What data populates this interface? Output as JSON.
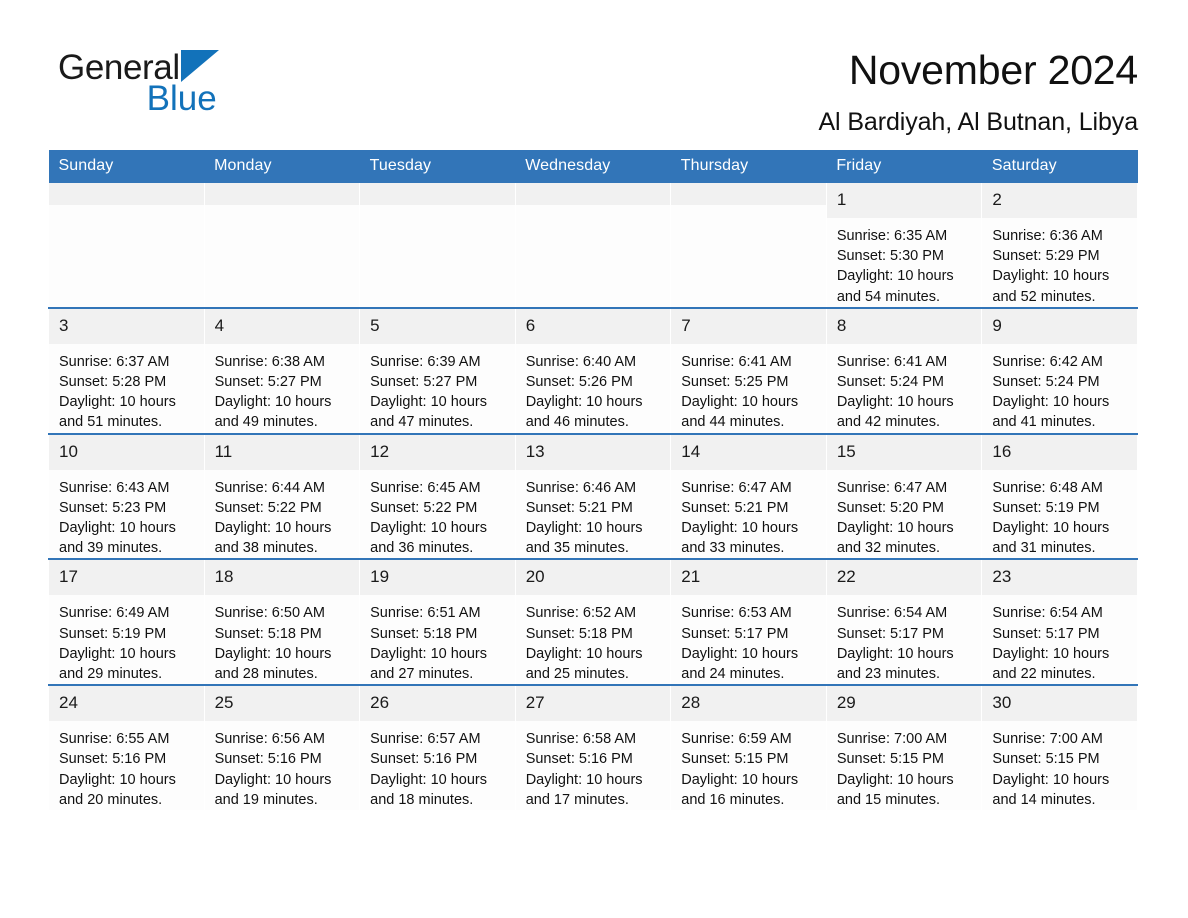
{
  "brand": {
    "word1": "General",
    "word2": "Blue",
    "triangle_color": "#1272BA"
  },
  "header": {
    "title": "November 2024",
    "subtitle": "Al Bardiyah, Al Butnan, Libya"
  },
  "theme": {
    "header_blue": "#3275B8",
    "daynum_gray": "#F1F1F1",
    "cell_white": "#FDFDFD",
    "text_black": "#111111"
  },
  "weekday_headers": [
    "Sunday",
    "Monday",
    "Tuesday",
    "Wednesday",
    "Thursday",
    "Friday",
    "Saturday"
  ],
  "labels": {
    "sunrise_prefix": "Sunrise:",
    "sunset_prefix": "Sunset:",
    "daylight_prefix": "Daylight:"
  },
  "weeks": [
    [
      {
        "day": "",
        "empty": true
      },
      {
        "day": "",
        "empty": true
      },
      {
        "day": "",
        "empty": true
      },
      {
        "day": "",
        "empty": true
      },
      {
        "day": "",
        "empty": true
      },
      {
        "day": "1",
        "sunrise": "Sunrise: 6:35 AM",
        "sunset": "Sunset: 5:30 PM",
        "daylight": "Daylight: 10 hours and 54 minutes."
      },
      {
        "day": "2",
        "sunrise": "Sunrise: 6:36 AM",
        "sunset": "Sunset: 5:29 PM",
        "daylight": "Daylight: 10 hours and 52 minutes."
      }
    ],
    [
      {
        "day": "3",
        "sunrise": "Sunrise: 6:37 AM",
        "sunset": "Sunset: 5:28 PM",
        "daylight": "Daylight: 10 hours and 51 minutes."
      },
      {
        "day": "4",
        "sunrise": "Sunrise: 6:38 AM",
        "sunset": "Sunset: 5:27 PM",
        "daylight": "Daylight: 10 hours and 49 minutes."
      },
      {
        "day": "5",
        "sunrise": "Sunrise: 6:39 AM",
        "sunset": "Sunset: 5:27 PM",
        "daylight": "Daylight: 10 hours and 47 minutes."
      },
      {
        "day": "6",
        "sunrise": "Sunrise: 6:40 AM",
        "sunset": "Sunset: 5:26 PM",
        "daylight": "Daylight: 10 hours and 46 minutes."
      },
      {
        "day": "7",
        "sunrise": "Sunrise: 6:41 AM",
        "sunset": "Sunset: 5:25 PM",
        "daylight": "Daylight: 10 hours and 44 minutes."
      },
      {
        "day": "8",
        "sunrise": "Sunrise: 6:41 AM",
        "sunset": "Sunset: 5:24 PM",
        "daylight": "Daylight: 10 hours and 42 minutes."
      },
      {
        "day": "9",
        "sunrise": "Sunrise: 6:42 AM",
        "sunset": "Sunset: 5:24 PM",
        "daylight": "Daylight: 10 hours and 41 minutes."
      }
    ],
    [
      {
        "day": "10",
        "sunrise": "Sunrise: 6:43 AM",
        "sunset": "Sunset: 5:23 PM",
        "daylight": "Daylight: 10 hours and 39 minutes."
      },
      {
        "day": "11",
        "sunrise": "Sunrise: 6:44 AM",
        "sunset": "Sunset: 5:22 PM",
        "daylight": "Daylight: 10 hours and 38 minutes."
      },
      {
        "day": "12",
        "sunrise": "Sunrise: 6:45 AM",
        "sunset": "Sunset: 5:22 PM",
        "daylight": "Daylight: 10 hours and 36 minutes."
      },
      {
        "day": "13",
        "sunrise": "Sunrise: 6:46 AM",
        "sunset": "Sunset: 5:21 PM",
        "daylight": "Daylight: 10 hours and 35 minutes."
      },
      {
        "day": "14",
        "sunrise": "Sunrise: 6:47 AM",
        "sunset": "Sunset: 5:21 PM",
        "daylight": "Daylight: 10 hours and 33 minutes."
      },
      {
        "day": "15",
        "sunrise": "Sunrise: 6:47 AM",
        "sunset": "Sunset: 5:20 PM",
        "daylight": "Daylight: 10 hours and 32 minutes."
      },
      {
        "day": "16",
        "sunrise": "Sunrise: 6:48 AM",
        "sunset": "Sunset: 5:19 PM",
        "daylight": "Daylight: 10 hours and 31 minutes."
      }
    ],
    [
      {
        "day": "17",
        "sunrise": "Sunrise: 6:49 AM",
        "sunset": "Sunset: 5:19 PM",
        "daylight": "Daylight: 10 hours and 29 minutes."
      },
      {
        "day": "18",
        "sunrise": "Sunrise: 6:50 AM",
        "sunset": "Sunset: 5:18 PM",
        "daylight": "Daylight: 10 hours and 28 minutes."
      },
      {
        "day": "19",
        "sunrise": "Sunrise: 6:51 AM",
        "sunset": "Sunset: 5:18 PM",
        "daylight": "Daylight: 10 hours and 27 minutes."
      },
      {
        "day": "20",
        "sunrise": "Sunrise: 6:52 AM",
        "sunset": "Sunset: 5:18 PM",
        "daylight": "Daylight: 10 hours and 25 minutes."
      },
      {
        "day": "21",
        "sunrise": "Sunrise: 6:53 AM",
        "sunset": "Sunset: 5:17 PM",
        "daylight": "Daylight: 10 hours and 24 minutes."
      },
      {
        "day": "22",
        "sunrise": "Sunrise: 6:54 AM",
        "sunset": "Sunset: 5:17 PM",
        "daylight": "Daylight: 10 hours and 23 minutes."
      },
      {
        "day": "23",
        "sunrise": "Sunrise: 6:54 AM",
        "sunset": "Sunset: 5:17 PM",
        "daylight": "Daylight: 10 hours and 22 minutes."
      }
    ],
    [
      {
        "day": "24",
        "sunrise": "Sunrise: 6:55 AM",
        "sunset": "Sunset: 5:16 PM",
        "daylight": "Daylight: 10 hours and 20 minutes."
      },
      {
        "day": "25",
        "sunrise": "Sunrise: 6:56 AM",
        "sunset": "Sunset: 5:16 PM",
        "daylight": "Daylight: 10 hours and 19 minutes."
      },
      {
        "day": "26",
        "sunrise": "Sunrise: 6:57 AM",
        "sunset": "Sunset: 5:16 PM",
        "daylight": "Daylight: 10 hours and 18 minutes."
      },
      {
        "day": "27",
        "sunrise": "Sunrise: 6:58 AM",
        "sunset": "Sunset: 5:16 PM",
        "daylight": "Daylight: 10 hours and 17 minutes."
      },
      {
        "day": "28",
        "sunrise": "Sunrise: 6:59 AM",
        "sunset": "Sunset: 5:15 PM",
        "daylight": "Daylight: 10 hours and 16 minutes."
      },
      {
        "day": "29",
        "sunrise": "Sunrise: 7:00 AM",
        "sunset": "Sunset: 5:15 PM",
        "daylight": "Daylight: 10 hours and 15 minutes."
      },
      {
        "day": "30",
        "sunrise": "Sunrise: 7:00 AM",
        "sunset": "Sunset: 5:15 PM",
        "daylight": "Daylight: 10 hours and 14 minutes."
      }
    ]
  ]
}
